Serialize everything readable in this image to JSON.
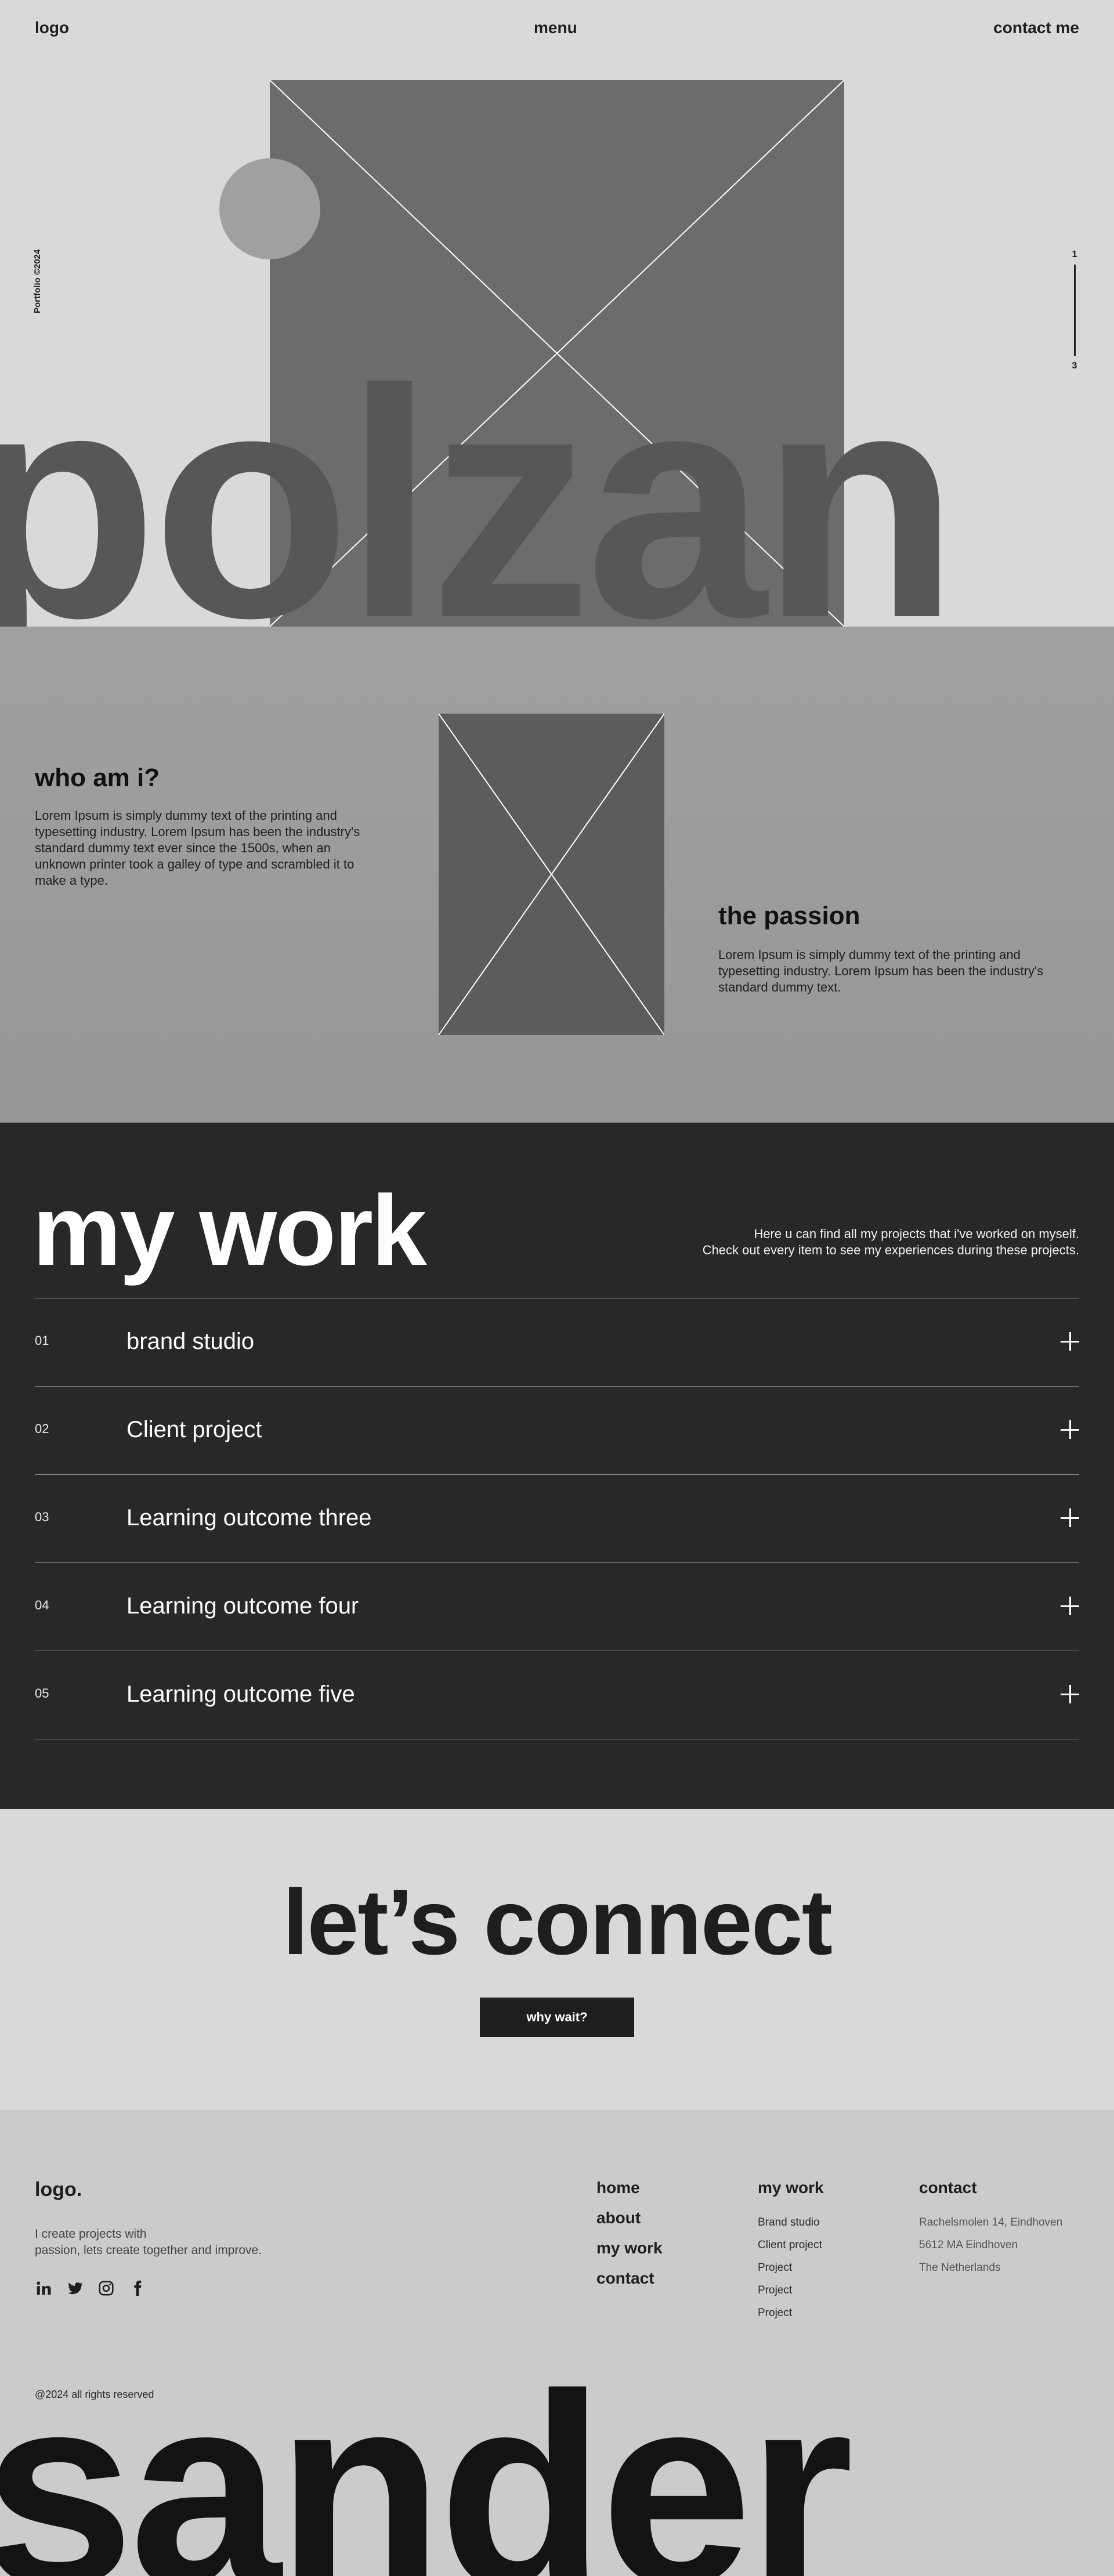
{
  "nav": {
    "logo": "logo",
    "menu": "menu",
    "contact": "contact me"
  },
  "hero": {
    "side_label": "Portfolio ©2024",
    "scroll_top": "1",
    "scroll_bottom": "3",
    "big_name": "polzan"
  },
  "about": {
    "who_title": "who am i?",
    "who_text": "Lorem Ipsum is simply dummy text of the printing and typesetting industry. Lorem Ipsum has been the industry's standard dummy text ever since the 1500s, when an unknown printer took a galley of type and scrambled it to make a type.",
    "passion_title": "the passion",
    "passion_text": "Lorem Ipsum is simply dummy text of the printing and typesetting industry. Lorem Ipsum has been the industry's standard dummy text."
  },
  "work": {
    "title": "my work",
    "desc_line1": "Here u can find all my projects that i've worked on myself.",
    "desc_line2": "Check out every item to see my experiences during these projects.",
    "items": [
      {
        "num": "01",
        "name": "brand studio"
      },
      {
        "num": "02",
        "name": "Client project"
      },
      {
        "num": "03",
        "name": "Learning outcome three"
      },
      {
        "num": "04",
        "name": "Learning outcome four"
      },
      {
        "num": "05",
        "name": "Learning outcome five"
      }
    ]
  },
  "connect": {
    "title": "let’s connect",
    "button": "why wait?"
  },
  "footer": {
    "logo": "logo.",
    "tag_line1": "I create projects with",
    "tag_line2": "passion, lets create together and improve.",
    "social": [
      "linkedin-icon",
      "twitter-icon",
      "instagram-icon",
      "facebook-icon"
    ],
    "nav": [
      "home",
      "about",
      "my work",
      "contact"
    ],
    "work_title": "my work",
    "work_links": [
      "Brand studio",
      "Client project",
      "Project",
      "Project",
      "Project"
    ],
    "contact_title": "contact",
    "address": [
      "Rachelsmolen 14, Eindhoven",
      "5612 MA Eindhoven",
      "The Netherlands"
    ],
    "copyright": "@2024 all rights reserved",
    "big_name": "sander"
  }
}
